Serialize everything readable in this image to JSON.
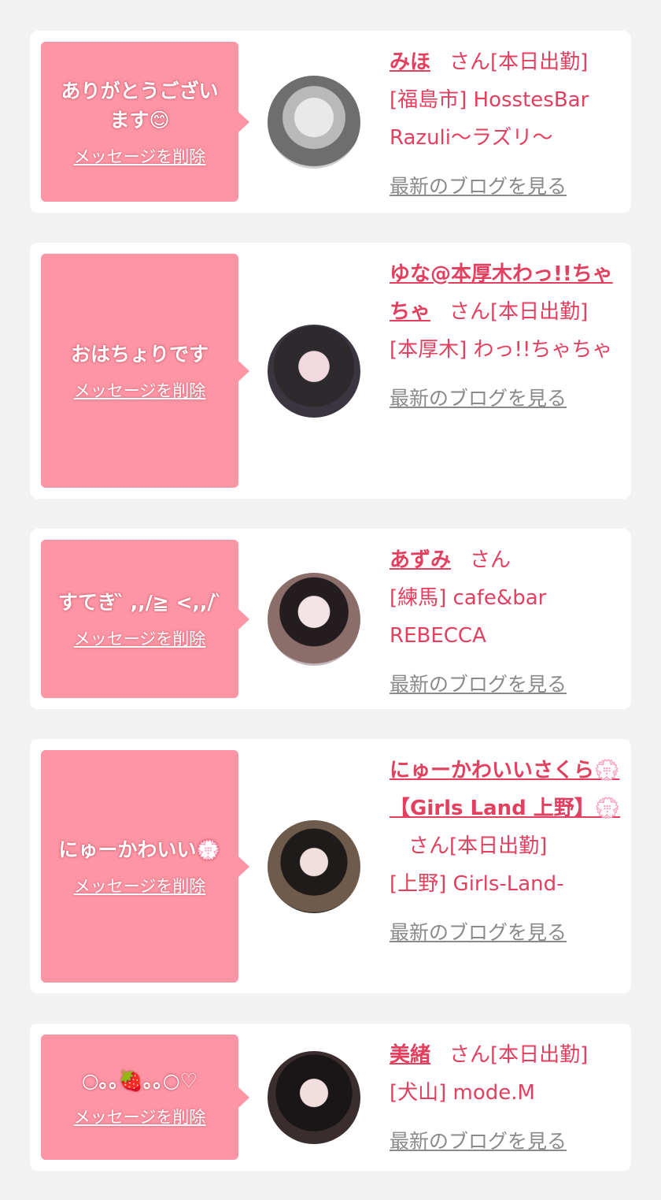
{
  "items": [
    {
      "message": "ありがとうございます😊",
      "delete_label": "メッセージを削除",
      "name": "みほ",
      "san": "さん[本日出勤]",
      "location": "[福島市] HosstesBar Razuli〜ラズリ〜",
      "blog_label": "最新のブログを見る",
      "avatar_icon": "avatar-photo"
    },
    {
      "message": "おはちょりです",
      "delete_label": "メッセージを削除",
      "name": "ゆな@本厚木わっ!!ちゃちゃ",
      "san": "さん[本日出勤]",
      "location": "[本厚木] わっ!!ちゃちゃ",
      "blog_label": "最新のブログを見る",
      "avatar_icon": "avatar-photo"
    },
    {
      "message": "すてき ̏ ,,/≧ <,,/ ̏",
      "delete_label": "メッセージを削除",
      "name": "あずみ",
      "san": "さん",
      "location": "[練馬] cafe&bar REBECCA",
      "blog_label": "最新のブログを見る",
      "avatar_icon": "avatar-photo"
    },
    {
      "message": "にゅーかわいい💮",
      "delete_label": "メッセージを削除",
      "name": "にゅーかわいいさくら💮【Girls Land 上野】💮",
      "san": "さん[本日出勤]",
      "location": "[上野] Girls-Land-",
      "blog_label": "最新のブログを見る",
      "avatar_icon": "avatar-photo"
    },
    {
      "message": "○｡｡🍓｡｡○♡",
      "delete_label": "メッセージを削除",
      "name": "美緒",
      "san": "さん[本日出勤]",
      "location": "[犬山] mode.M",
      "blog_label": "最新のブログを見る",
      "avatar_icon": "avatar-photo"
    }
  ]
}
